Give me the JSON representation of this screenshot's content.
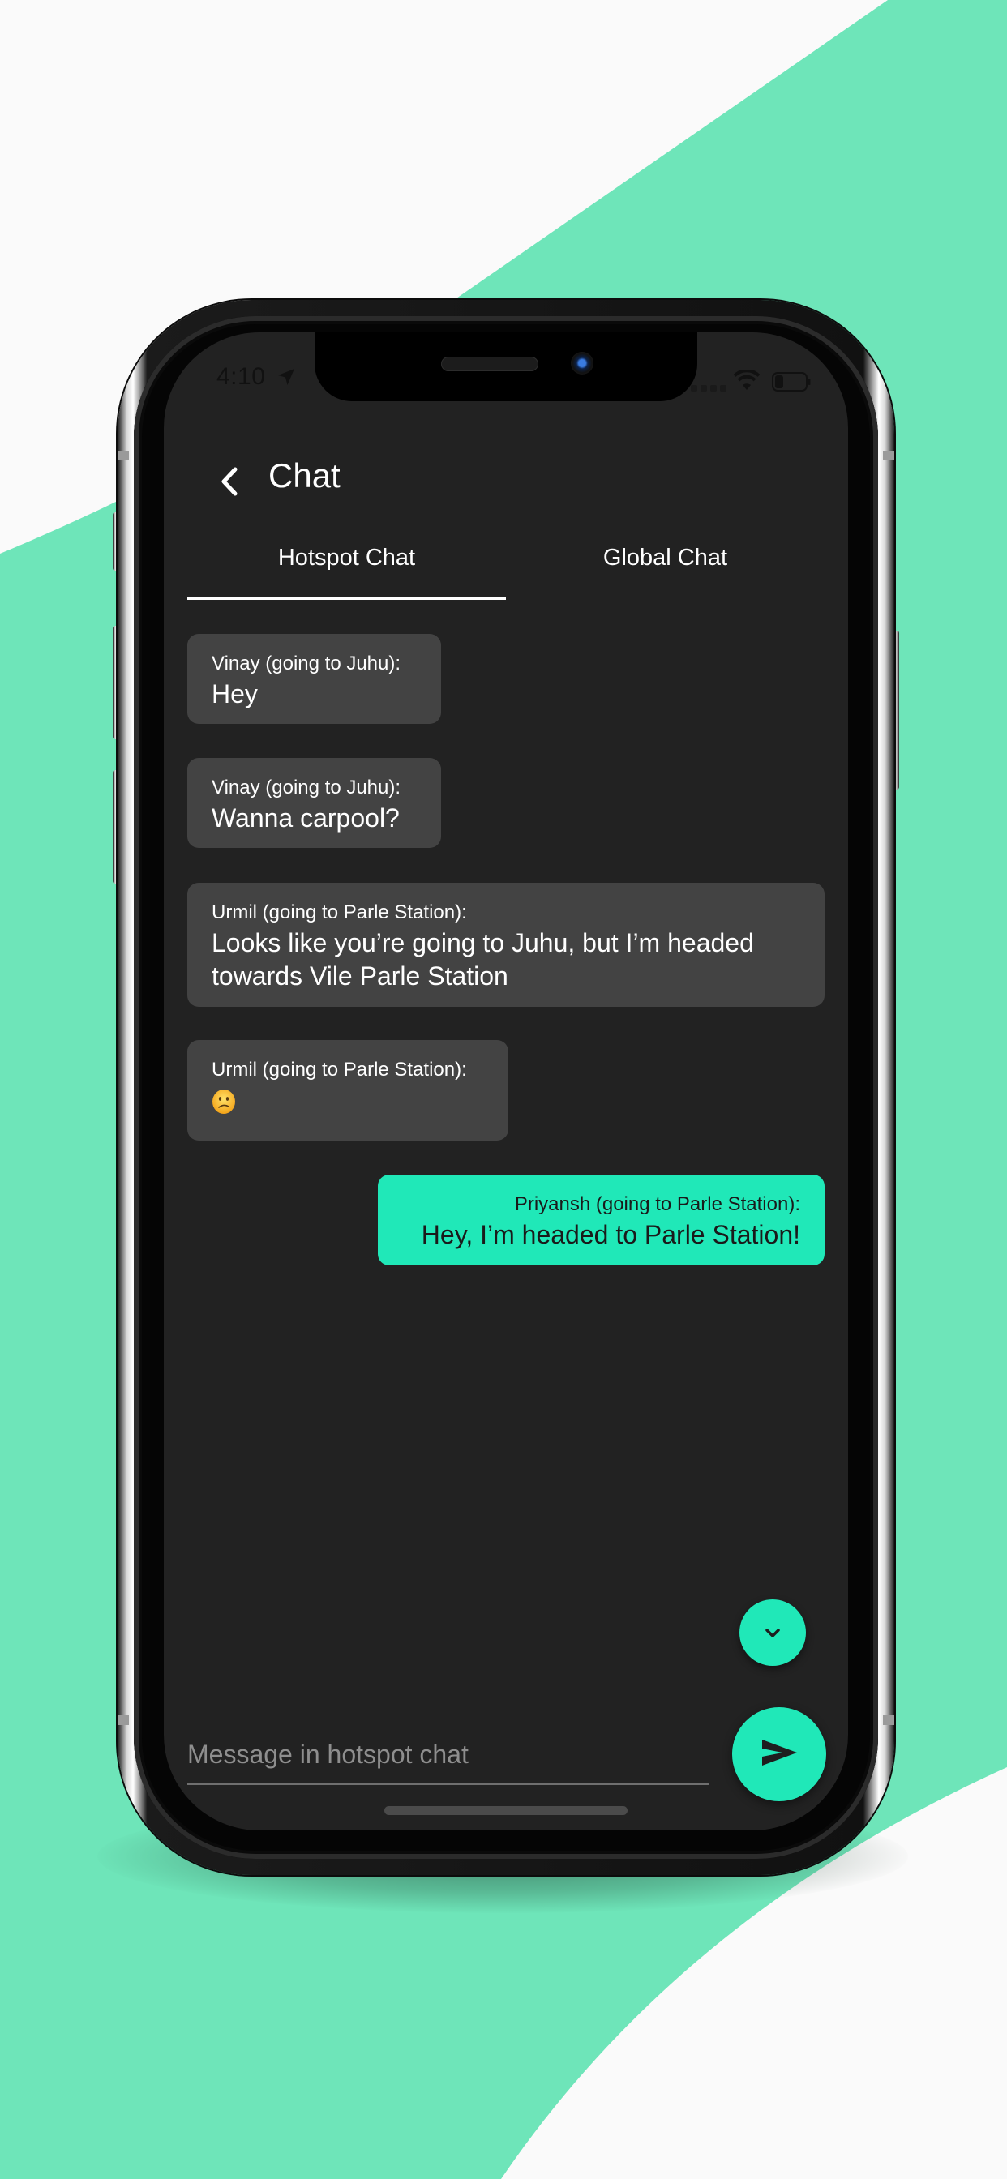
{
  "colors": {
    "background_light": "#fafafa",
    "background_accent": "#6ee5b9",
    "screen_bg": "#222222",
    "bubble_other": "#434343",
    "bubble_mine": "#20e8b8",
    "accent": "#20e8b8"
  },
  "status_bar": {
    "time": "4:10",
    "icons": [
      "location-arrow-icon",
      "signal-icon",
      "wifi-icon",
      "battery-icon"
    ]
  },
  "header": {
    "back_icon": "chevron-left-icon",
    "title": "Chat"
  },
  "tabs": [
    {
      "label": "Hotspot Chat",
      "active": true
    },
    {
      "label": "Global Chat",
      "active": false
    }
  ],
  "messages": [
    {
      "sender": "Vinay (going to Juhu):",
      "text": "Hey",
      "mine": false
    },
    {
      "sender": "Vinay (going to Juhu):",
      "text": "Wanna carpool?",
      "mine": false
    },
    {
      "sender": "Urmil (going to Parle Station):",
      "text": "Looks like you’re going to Juhu, but I’m headed towards Vile Parle Station",
      "mine": false
    },
    {
      "sender": "Urmil (going to Parle Station):",
      "text": "",
      "emoji": "confused-face-emoji",
      "mine": false
    },
    {
      "sender": "Priyansh (going to Parle Station):",
      "text": "Hey, I’m headed to Parle Station!",
      "mine": true
    }
  ],
  "composer": {
    "placeholder": "Message in hotspot chat",
    "value": "",
    "send_icon": "send-icon",
    "scroll_down_icon": "chevron-down-icon"
  }
}
